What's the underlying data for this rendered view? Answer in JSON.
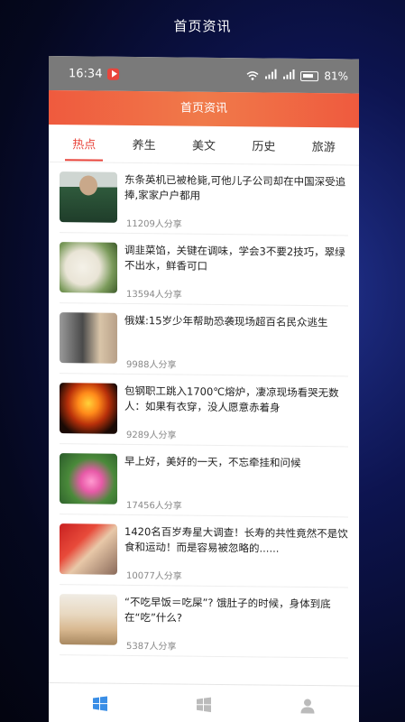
{
  "outer_title": "首页资讯",
  "status_bar": {
    "time": "16:34",
    "battery_percent": "81%",
    "signal": "⁵ᴳ"
  },
  "header": {
    "title": "首页资讯"
  },
  "tabs": [
    {
      "label": "热点",
      "active": true
    },
    {
      "label": "养生",
      "active": false
    },
    {
      "label": "美文",
      "active": false
    },
    {
      "label": "历史",
      "active": false
    },
    {
      "label": "旅游",
      "active": false
    }
  ],
  "news": [
    {
      "title": "东条英机已被枪毙,可他儿子公司却在中国深受追捧,家家户户都用",
      "shares": "11209人分享"
    },
    {
      "title": "调韭菜馅，关键在调味，学会3不要2技巧，翠绿不出水，鲜香可口",
      "shares": "13594人分享"
    },
    {
      "title": "俄媒:15岁少年帮助恐袭现场超百名民众逃生",
      "shares": "9988人分享"
    },
    {
      "title": "包钢职工跳入1700℃熔炉，凄凉现场看哭无数人：如果有衣穿，没人愿意赤着身",
      "shares": "9289人分享"
    },
    {
      "title": "早上好，美好的一天，不忘牵挂和问候",
      "shares": "17456人分享"
    },
    {
      "title": "1420名百岁寿星大调查！长寿的共性竟然不是饮食和运动！而是容易被忽略的......",
      "shares": "10077人分享"
    },
    {
      "title": "“不吃早饭＝吃屎”? 饿肚子的时候，身体到底在“吃”什么?",
      "shares": "5387人分享"
    }
  ],
  "colors": {
    "accent": "#e8453c",
    "header_gradient": "#ef5a3e",
    "nav_active": "#3a8ee6",
    "nav_inactive": "#bbbbbb"
  },
  "bottom_nav": {
    "items": [
      "windows-icon",
      "grid-icon",
      "user-icon"
    ]
  }
}
